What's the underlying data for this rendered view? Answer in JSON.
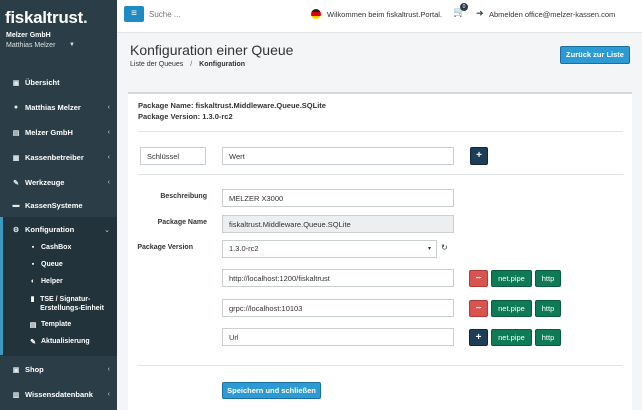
{
  "sidebar": {
    "brand": "fiskaltrust",
    "brand_dot": ".",
    "org_name": "Melzer GmbH",
    "user_name": "Matthias Melzer",
    "items": [
      {
        "label": "Übersicht",
        "icon": "dashboard-icon",
        "chevron": ""
      },
      {
        "label": "Matthias Melzer",
        "icon": "user-icon",
        "chevron": "‹"
      },
      {
        "label": "Melzer GmbH",
        "icon": "briefcase-icon",
        "chevron": "‹"
      },
      {
        "label": "Kassenbetreiber",
        "icon": "store-icon",
        "chevron": "‹"
      },
      {
        "label": "Werkzeuge",
        "icon": "wrench-icon",
        "chevron": "‹"
      },
      {
        "label": "KassenSysteme",
        "icon": "pos-icon",
        "chevron": ""
      },
      {
        "label": "Konfiguration",
        "icon": "cogs-icon",
        "chevron": "⌄"
      },
      {
        "label": "Shop",
        "icon": "shop-icon",
        "chevron": "‹"
      },
      {
        "label": "Wissensdatenbank",
        "icon": "book-icon",
        "chevron": "‹"
      }
    ],
    "subitems": [
      {
        "label": "CashBox",
        "icon": "cashbox-icon"
      },
      {
        "label": "Queue",
        "icon": "queue-icon"
      },
      {
        "label": "Helper",
        "icon": "helper-icon"
      },
      {
        "label": "TSE / Signatur-Erstellungs-Einheit",
        "icon": "signature-icon"
      },
      {
        "label": "Template",
        "icon": "template-icon"
      },
      {
        "label": "Aktualisierung",
        "icon": "update-icon"
      }
    ]
  },
  "topbar": {
    "menu_icon": "hamburger-icon",
    "search_placeholder": "Suche ...",
    "welcome": "Wilkommen beim fiskaltrust.Portal.",
    "cart_count": "0",
    "logout": "Abmelden office@melzer-kassen.com"
  },
  "header": {
    "title": "Konfiguration einer Queue",
    "breadcrumb_link": "Liste der Queues",
    "breadcrumb_sep": "/",
    "breadcrumb_current": "Konfiguration",
    "back_button": "Zurück zur Liste"
  },
  "package": {
    "name_line": "Package Name: fiskaltrust.Middleware.Queue.SQLite",
    "version_line": "Package Version: 1.3.0-rc2"
  },
  "keyvalue": {
    "key_placeholder": "Schlüssel",
    "value_placeholder": "Wert",
    "add_label": "+"
  },
  "form": {
    "description_label": "Beschreibung",
    "description_value": "MELZER X3000",
    "package_name_label": "Package Name",
    "package_name_value": "fiskaltrust.Middleware.Queue.SQLite",
    "package_version_label": "Package Version",
    "package_version_value": "1.3.0-rc2",
    "arrow": "▾",
    "refresh": "↻"
  },
  "urls": [
    {
      "value": "http://localhost:1200/fiskaltrust",
      "action": "−"
    },
    {
      "value": "grpc://localhost:10103",
      "action": "−"
    },
    {
      "value": "Url",
      "action": "+"
    }
  ],
  "protocol_buttons": {
    "netpipe": "net.pipe",
    "http": "http"
  },
  "save_button": "Speichern und schließen",
  "colors": {
    "sidebar": "#2b3e47",
    "primary": "#2d9bd3",
    "danger": "#d9534f",
    "success": "#0f7a56",
    "dark": "#1c3e58"
  }
}
